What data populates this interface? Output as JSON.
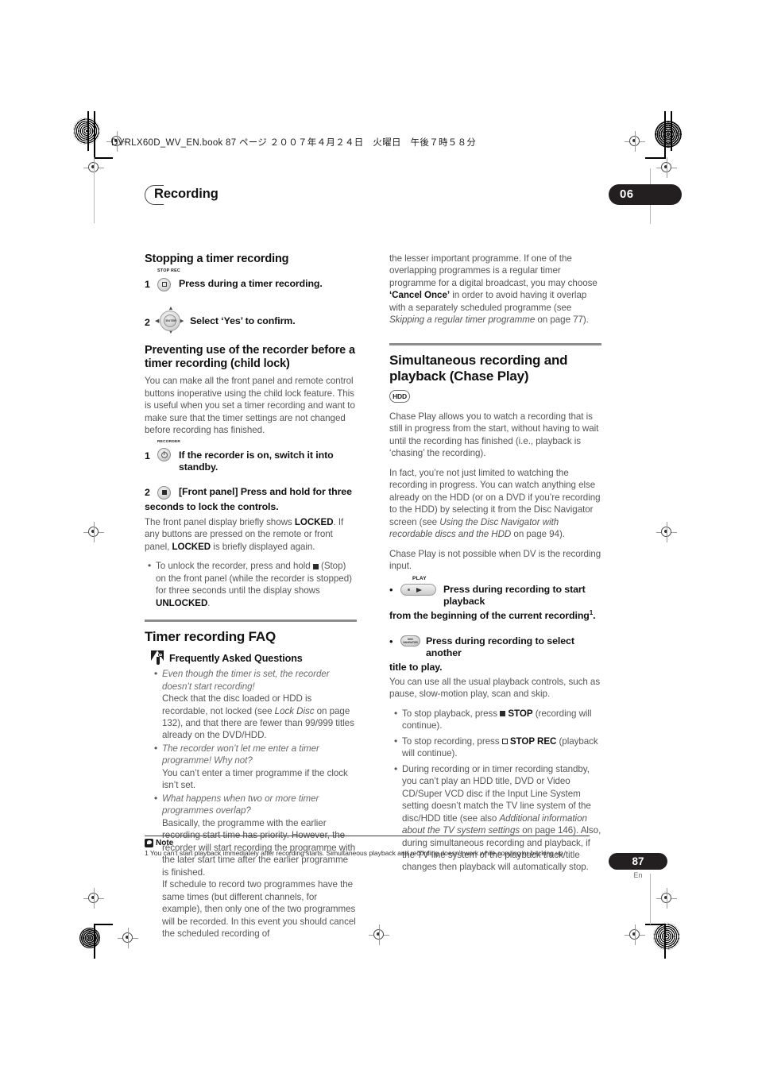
{
  "print_marks": {
    "file_header": "DVRLX60D_WV_EN.book 87 ページ ２００７年４月２４日　火曜日　午後７時５８分"
  },
  "running_head": {
    "title": "Recording",
    "chapter_number": "06"
  },
  "left_column": {
    "section1": {
      "heading": "Stopping a timer recording",
      "steps": [
        {
          "number": "1",
          "icon": "stop-rec-button-icon",
          "caption": "STOP REC",
          "text": "Press during a timer recording."
        },
        {
          "number": "2",
          "icon": "cursor-pad-enter-icon",
          "caption": "ENTER",
          "text": "Select ‘Yes’ to confirm."
        }
      ]
    },
    "section2": {
      "heading": "Preventing use of the recorder before a timer recording (child lock)",
      "intro": "You can make all the front panel and remote control buttons inoperative using the child lock feature. This is useful when you set a timer recording and want to make sure that the timer settings are not changed before recording has finished.",
      "step1": {
        "number": "1",
        "icon": "recorder-standby-button-icon",
        "caption": "RECORDER",
        "text": "If the recorder is on, switch it into standby."
      },
      "step2": {
        "number": "2",
        "icon": "stop-button-icon",
        "text_line1": "[Front panel] Press and hold for three",
        "text_line2": "seconds to lock the controls."
      },
      "after_step2_html": "The front panel display briefly shows <b>LOCKED</b>. If any buttons are pressed on the remote or front panel, <b>LOCKED</b> is briefly displayed again.",
      "bullet": "To unlock the recorder, press and hold ■ (Stop) on the front panel (while the recorder is stopped) for three seconds until the display shows UNLOCKED."
    },
    "faq": {
      "heading": "Timer recording FAQ",
      "subhead": "Frequently Asked Questions",
      "items": [
        {
          "question": "Even though the timer is set, the recorder doesn’t start recording!",
          "answer_html": "Check that the disc loaded or HDD is recordable, not locked (see <i>Lock Disc</i> on page 132), and that there are fewer than 99/999 titles already on the DVD/HDD."
        },
        {
          "question": "The recorder won’t let me enter a timer programme! Why not?",
          "answer_html": "You can’t enter a timer programme if the clock isn’t set."
        },
        {
          "question": "What happens when two or more timer programmes overlap?",
          "answer_html": "Basically, the programme with the earlier recording start time has priority. However, the recorder will start recording the programme with the later start time after the earlier programme is finished.<br>If schedule to record two programmes have the same times (but different channels, for example),  then only one of the two programmes will be recorded. In this event you should cancel the scheduled recording of"
        }
      ]
    }
  },
  "right_column": {
    "continuation_html": "the lesser important programme. If one of the overlapping programmes is a regular timer programme for a digital broadcast, you may choose <b>‘Cancel Once’</b> in order to avoid having it overlap with a separately scheduled programme (see <i>Skipping a regular timer programme</i> on page 77).",
    "section": {
      "heading_line1": "Simultaneous recording and",
      "heading_line2": "playback (Chase Play)",
      "media_badge": "HDD",
      "para1": "Chase Play allows you to watch a recording that is still in progress from the start, without having to wait until the recording has finished (i.e., playback is ‘chasing’ the recording).",
      "para2_html": "In fact, you’re not just limited to watching the recording in progress. You can watch anything else already on the HDD (or on a DVD if you’re recording to the HDD) by selecting it from the Disc Navigator screen (see <i>Using the Disc Navigator with recordable discs and the HDD</i> on page 94).",
      "para3": "Chase Play is not possible when DV is the recording input.",
      "action1": {
        "icon": "play-button-icon",
        "caption": "PLAY",
        "text_line1": "Press during recording to start playback",
        "text_line2": "from the beginning of the current recording",
        "footnote_ref": "1"
      },
      "action2": {
        "icon": "disc-navigator-button-icon",
        "caption": "DISC NAVIGATOR",
        "text_line1": "Press during recording to select another",
        "text_line2": "title to play."
      },
      "after_actions": "You can use all the usual playback controls, such as pause, slow-motion play, scan and skip.",
      "bullets": [
        "To stop playback, press ■ STOP (recording will continue).",
        "To stop recording, press ▫ STOP REC (playback will continue).",
        "During recording or in timer recording standby, you can’t play an HDD title, DVD or Video CD/Super VCD disc if the Input Line System setting doesn’t match the TV line system of the disc/HDD title (see also Additional information about the TV system settings on page 146). Also, during simultaneous recording and playback, if the TV line system of the playback track/title changes then playback will automatically stop."
      ]
    }
  },
  "footnote": {
    "label": "Note",
    "text": "1 You can’t start playback immediately after recording starts. Simultaneous playback and recording doesn’t work while copying or backing up."
  },
  "page_footer": {
    "number": "87",
    "language": "En"
  },
  "colors": {
    "badge_black": "#231f20",
    "body_grey": "#555555",
    "heading_black": "#111111",
    "rule_grey": "#8d8d8d"
  }
}
